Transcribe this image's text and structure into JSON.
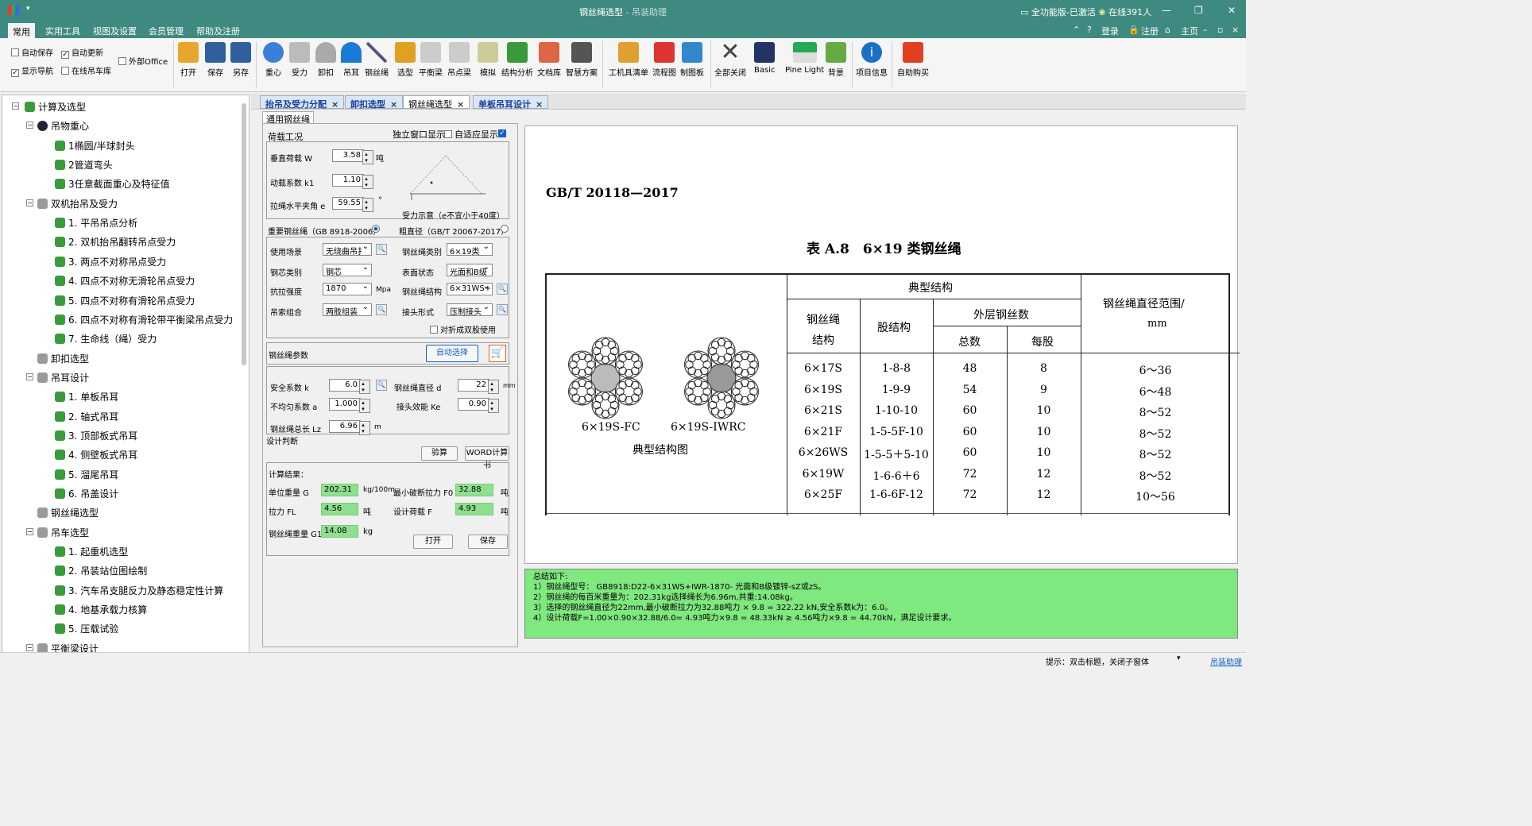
{
  "window": {
    "title": "钢丝绳选型",
    "app_name": "吊装助理",
    "separator": " - ",
    "status": "全功能版-已激活",
    "online": "在线391人",
    "minimize": "—",
    "restore": "❐",
    "close": "✕"
  },
  "menu": {
    "tabs": [
      "常用",
      "实用工具",
      "视图及设置",
      "会员管理",
      "帮助及注册"
    ],
    "login": "登录",
    "register": "注册",
    "home": "主页"
  },
  "ribbon": {
    "checks": [
      {
        "label": "自动保存",
        "checked": false
      },
      {
        "label": "自动更新",
        "checked": true
      },
      {
        "label": "外部Office",
        "checked": false
      },
      {
        "label": "显示导航",
        "checked": true
      },
      {
        "label": "在线吊车库",
        "checked": false
      }
    ],
    "buttons": [
      "打开",
      "保存",
      "另存",
      "重心",
      "受力",
      "卸扣",
      "吊耳",
      "钢丝绳",
      "选型",
      "平衡梁",
      "吊点梁",
      "模拟",
      "结构分析",
      "文档库",
      "智慧方案",
      "工机具清单",
      "流程图",
      "制图板",
      "全部关闭",
      "Basic",
      "Pine Light",
      "背景",
      "项目信息",
      "自助购买"
    ],
    "colors": {
      "open": "#e8a72c",
      "save": "#2f5f9e",
      "saveas": "#2f5f9e",
      "center": "#3a7fd8",
      "force": "#8a8a8a",
      "shackle": "#8a8a8a",
      "lug": "#1a7ad8",
      "rope": "#557",
      "select": "#e0a020",
      "beam": "#999",
      "pointbeam": "#999",
      "simulate": "#997",
      "analysis": "#3a9a3a",
      "doclib": "#d64",
      "smart": "#555",
      "toollist": "#e0a030",
      "flow": "#d33",
      "draw": "#38c",
      "closeall": "#444",
      "basic": "#236",
      "pine": "#2a5",
      "bg": "#6a4",
      "info": "#1a6fc8",
      "buy": "#e04020"
    }
  },
  "tree": {
    "items": [
      {
        "label": "计算及选型",
        "level": 0,
        "icon": "gear-green"
      },
      {
        "label": "吊物重心",
        "level": 1,
        "icon": "pie"
      },
      {
        "label": "1椭圆/半球封头",
        "level": 2,
        "icon": "gear-green"
      },
      {
        "label": "2管道弯头",
        "level": 2,
        "icon": "gear-green"
      },
      {
        "label": "3任意截面重心及特征值",
        "level": 2,
        "icon": "gear-green"
      },
      {
        "label": "双机抬吊及受力",
        "level": 1,
        "icon": "gray"
      },
      {
        "label": "1. 平吊吊点分析",
        "level": 2,
        "icon": "gear-green"
      },
      {
        "label": "2. 双机抬吊翻转吊点受力",
        "level": 2,
        "icon": "gear-green"
      },
      {
        "label": "3. 两点不对称吊点受力",
        "level": 2,
        "icon": "gear-green"
      },
      {
        "label": "4. 四点不对称无滑轮吊点受力",
        "level": 2,
        "icon": "gear-green"
      },
      {
        "label": "5. 四点不对称有滑轮吊点受力",
        "level": 2,
        "icon": "gear-green"
      },
      {
        "label": "6. 四点不对称有滑轮带平衡梁吊点受力",
        "level": 2,
        "icon": "gear-green"
      },
      {
        "label": "7. 生命线（绳）受力",
        "level": 2,
        "icon": "gear-green"
      },
      {
        "label": "卸扣选型",
        "level": 1,
        "icon": "gray"
      },
      {
        "label": "吊耳设计",
        "level": 1,
        "icon": "gray"
      },
      {
        "label": "1. 单板吊耳",
        "level": 2,
        "icon": "gear-green"
      },
      {
        "label": "2. 轴式吊耳",
        "level": 2,
        "icon": "gear-green"
      },
      {
        "label": "3. 顶部板式吊耳",
        "level": 2,
        "icon": "gear-green"
      },
      {
        "label": "4. 侧壁板式吊耳",
        "level": 2,
        "icon": "gear-green"
      },
      {
        "label": "5. 溜尾吊耳",
        "level": 2,
        "icon": "gear-green"
      },
      {
        "label": "6. 吊盖设计",
        "level": 2,
        "icon": "gear-green"
      },
      {
        "label": "钢丝绳选型",
        "level": 1,
        "icon": "gray"
      },
      {
        "label": "吊车选型",
        "level": 1,
        "icon": "gray"
      },
      {
        "label": "1. 起重机选型",
        "level": 2,
        "icon": "gear-green"
      },
      {
        "label": "2. 吊装站位图绘制",
        "level": 2,
        "icon": "gear-green"
      },
      {
        "label": "3. 汽车吊支腿反力及静态稳定性计算",
        "level": 2,
        "icon": "gear-green"
      },
      {
        "label": "4. 地基承载力核算",
        "level": 2,
        "icon": "gear-green"
      },
      {
        "label": "5. 压载试验",
        "level": 2,
        "icon": "gear-green"
      },
      {
        "label": "平衡梁设计",
        "level": 1,
        "icon": "gray"
      }
    ]
  },
  "doc_tabs": [
    {
      "label": "抬吊及受力分配",
      "active": false
    },
    {
      "label": "卸扣选型",
      "active": false
    },
    {
      "label": "钢丝绳选型",
      "active": true
    },
    {
      "label": "单板吊耳设计",
      "active": false
    }
  ],
  "inner_tab": "通用钢丝绳",
  "form": {
    "load_group": "荷载工况",
    "standalone": "独立窗口显示",
    "adaptive": "自适应显示",
    "vertical_load_label": "垂直荷载 W",
    "vertical_load": "3.58",
    "ton": "吨",
    "dyn_label": "动载系数 k1",
    "dyn": "1.10",
    "angle_label": "拉绳水平夹角 e",
    "angle": "59.55",
    "deg": "°",
    "diagram_caption": "受力示意（e不宜小于40度）",
    "std1": "重要钢丝绳（GB 8918-2006）",
    "std2": "粗直径（GB/T 20067-2017）",
    "use_label": "使用场景",
    "use": "无绕曲吊扌",
    "type_label": "钢丝绳类别",
    "type": "6×19类",
    "core_label": "钢芯类别",
    "core": "钢芯",
    "surface_label": "表面状态",
    "surface": "光面和B级",
    "strength_label": "抗拉强度",
    "strength": "1870",
    "mpa": "Mpa",
    "struct_label": "钢丝绳结构",
    "struct": "6×31WS+I",
    "combo_label": "吊索组合",
    "combo": "两肢组装",
    "joint_label": "接头形式",
    "joint": "压制接头",
    "fold": "对折成双股使用",
    "params": "钢丝绳参数",
    "auto_select": "自动选择",
    "safety_label": "安全系数 k",
    "safety": "6.0",
    "dia_label": "钢丝绳直径 d",
    "dia": "22",
    "mm": "mm",
    "uneven_label": "不均匀系数 a",
    "uneven": "1.000",
    "eff_label": "接头效能 Ke",
    "eff": "0.90",
    "len_label": "钢丝绳总长 Lz",
    "len": "6.96",
    "m": "m",
    "judge": "设计判断",
    "check": "验算",
    "word": "WORD计算书",
    "result_title": "计算结果：",
    "unitw_label": "单位重量 G",
    "unitw": "202.31",
    "unitw_unit": "kg/100m",
    "minbreak_label": "最小破断拉力 F0",
    "minbreak": "32.88",
    "pull_label": "拉力 FL",
    "pull": "4.56",
    "design_label": "设计荷载 F",
    "design": "4.93",
    "weight_label": "钢丝绳重量 G1",
    "weight": "14.08",
    "kg": "kg",
    "open": "打开",
    "save": "保存"
  },
  "standard": {
    "code": "GB/T 20118—2017",
    "table_title": "表 A.8　6×19 类钢丝绳",
    "headers": {
      "typical": "典型结构",
      "rope_struct": "钢丝绳结构",
      "strand_struct": "股结构",
      "outer": "外层钢丝数",
      "total": "总数",
      "per": "每股",
      "range": "钢丝绳直径范围/",
      "range_unit": "mm"
    },
    "diagram_labels": [
      "6×19S-FC",
      "6×19S-IWRC"
    ],
    "diagram_caption": "典型结构图",
    "rows": [
      {
        "rope": "6×17S",
        "strand": "1-8-8",
        "total": "48",
        "per": "8",
        "range": "6～36"
      },
      {
        "rope": "6×19S",
        "strand": "1-9-9",
        "total": "54",
        "per": "9",
        "range": "6～48"
      },
      {
        "rope": "6×21S",
        "strand": "1-10-10",
        "total": "60",
        "per": "10",
        "range": "8～52"
      },
      {
        "rope": "6×21F",
        "strand": "1-5-5F-10",
        "total": "60",
        "per": "10",
        "range": "8～52"
      },
      {
        "rope": "6×26WS",
        "strand": "1-5-5＋5-10",
        "total": "60",
        "per": "10",
        "range": "8～52"
      },
      {
        "rope": "6×19W",
        "strand": "1-6-6＋6",
        "total": "72",
        "per": "12",
        "range": "8～52"
      },
      {
        "rope": "6×25F",
        "strand": "1-6-6F-12",
        "total": "72",
        "per": "12",
        "range": "10～56"
      }
    ]
  },
  "summary": {
    "title": "总结如下:",
    "lines": [
      "1）钢丝绳型号：  GB8918:D22-6×31WS+IWR-1870- 光面和B级镀锌-sZ或zS。",
      "2）钢丝绳的每百米重量为：202.31kg选择绳长为6.96m,共重:14.08kg。",
      "3）选择的钢丝绳直径为22mm,最小破断拉力为32.88吨力  × 9.8 = 322.22 kN,安全系数k为：6.0。",
      "4）设计荷载F=1.00×0.90×32.88/6.0= 4.93吨力×9.8 = 48.33kN ≥ 4.56吨力×9.8 = 44.70kN，满足设计要求。"
    ]
  },
  "statusbar": {
    "hint": "提示：双击标题，关闭子窗体",
    "link": "吊装助理"
  }
}
